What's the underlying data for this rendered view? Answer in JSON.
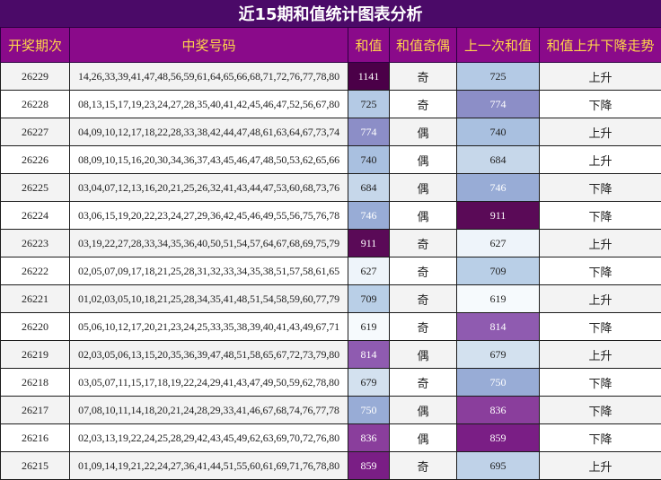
{
  "title": "近15期和值统计图表分析",
  "headers": [
    "开奖期次",
    "中奖号码",
    "和值",
    "和值奇偶",
    "上一次和值",
    "和值上升下降走势"
  ],
  "rows": [
    {
      "period": "26229",
      "numbers": "14,26,33,39,41,47,48,56,59,61,64,65,66,68,71,72,76,77,78,80",
      "sum": "1141",
      "parity": "奇",
      "prev_sum": "725",
      "trend": "上升"
    },
    {
      "period": "26228",
      "numbers": "08,13,15,17,19,23,24,27,28,35,40,41,42,45,46,47,52,56,67,80",
      "sum": "725",
      "parity": "奇",
      "prev_sum": "774",
      "trend": "下降"
    },
    {
      "period": "26227",
      "numbers": "04,09,10,12,17,18,22,28,33,38,42,44,47,48,61,63,64,67,73,74",
      "sum": "774",
      "parity": "偶",
      "prev_sum": "740",
      "trend": "上升"
    },
    {
      "period": "26226",
      "numbers": "08,09,10,15,16,20,30,34,36,37,43,45,46,47,48,50,53,62,65,66",
      "sum": "740",
      "parity": "偶",
      "prev_sum": "684",
      "trend": "上升"
    },
    {
      "period": "26225",
      "numbers": "03,04,07,12,13,16,20,21,25,26,32,41,43,44,47,53,60,68,73,76",
      "sum": "684",
      "parity": "偶",
      "prev_sum": "746",
      "trend": "下降"
    },
    {
      "period": "26224",
      "numbers": "03,06,15,19,20,22,23,24,27,29,36,42,45,46,49,55,56,75,76,78",
      "sum": "746",
      "parity": "偶",
      "prev_sum": "911",
      "trend": "下降"
    },
    {
      "period": "26223",
      "numbers": "03,19,22,27,28,33,34,35,36,40,50,51,54,57,64,67,68,69,75,79",
      "sum": "911",
      "parity": "奇",
      "prev_sum": "627",
      "trend": "上升"
    },
    {
      "period": "26222",
      "numbers": "02,05,07,09,17,18,21,25,28,31,32,33,34,35,38,51,57,58,61,65",
      "sum": "627",
      "parity": "奇",
      "prev_sum": "709",
      "trend": "下降"
    },
    {
      "period": "26221",
      "numbers": "01,02,03,05,10,18,21,25,28,34,35,41,48,51,54,58,59,60,77,79",
      "sum": "709",
      "parity": "奇",
      "prev_sum": "619",
      "trend": "上升"
    },
    {
      "period": "26220",
      "numbers": "05,06,10,12,17,20,21,23,24,25,33,35,38,39,40,41,43,49,67,71",
      "sum": "619",
      "parity": "奇",
      "prev_sum": "814",
      "trend": "下降"
    },
    {
      "period": "26219",
      "numbers": "02,03,05,06,13,15,20,35,36,39,47,48,51,58,65,67,72,73,79,80",
      "sum": "814",
      "parity": "偶",
      "prev_sum": "679",
      "trend": "上升"
    },
    {
      "period": "26218",
      "numbers": "03,05,07,11,15,17,18,19,22,24,29,41,43,47,49,50,59,62,78,80",
      "sum": "679",
      "parity": "奇",
      "prev_sum": "750",
      "trend": "下降"
    },
    {
      "period": "26217",
      "numbers": "07,08,10,11,14,18,20,21,24,28,29,33,41,46,67,68,74,76,77,78",
      "sum": "750",
      "parity": "偶",
      "prev_sum": "836",
      "trend": "下降"
    },
    {
      "period": "26216",
      "numbers": "02,03,13,19,22,24,25,28,29,42,43,45,49,62,63,69,70,72,76,80",
      "sum": "836",
      "parity": "偶",
      "prev_sum": "859",
      "trend": "下降"
    },
    {
      "period": "26215",
      "numbers": "01,09,14,19,21,22,24,27,36,41,44,51,55,60,61,69,71,76,78,80",
      "sum": "859",
      "parity": "奇",
      "prev_sum": "695",
      "trend": "上升"
    }
  ],
  "colors": {
    "title_bg": "#4b0a68",
    "header_bg": "#8a0a8a",
    "header_text": "#ffd54a",
    "row_odd": "#f3f3f3",
    "row_even": "#ffffff",
    "heat_low": "#f6fafd",
    "heat_mid1": "#c5d8ea",
    "heat_mid2": "#9fb9dc",
    "heat_mid3": "#8c8ec7",
    "heat_high1": "#8a48a8",
    "heat_high2": "#7a1e85",
    "heat_top": "#4b0048"
  }
}
